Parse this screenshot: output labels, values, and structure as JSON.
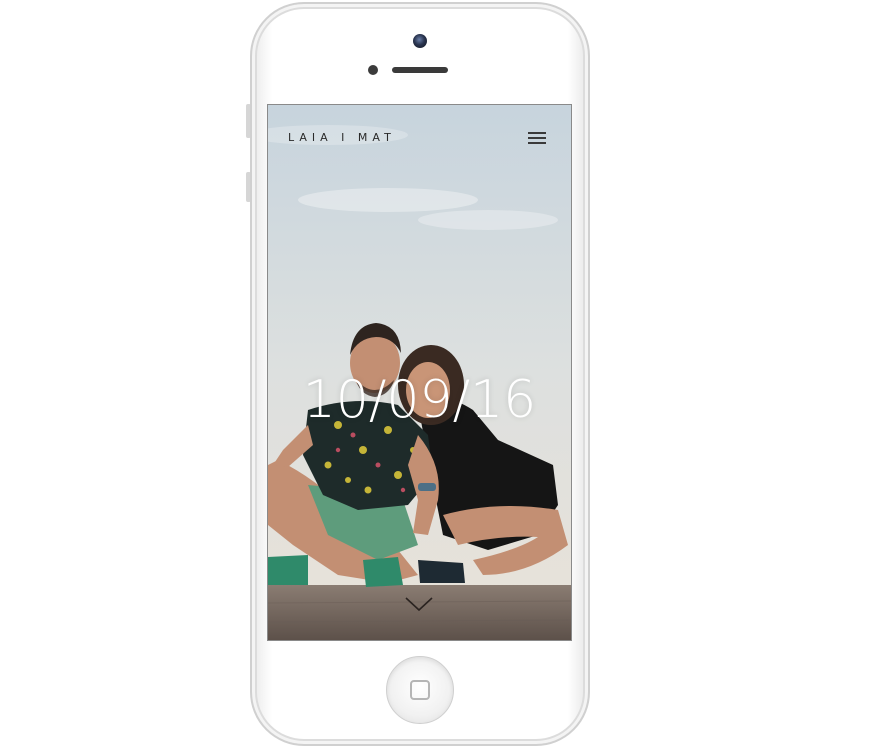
{
  "site": {
    "title": "LAIA I MAT",
    "menu_icon": "hamburger-menu-icon"
  },
  "hero": {
    "date": "10/09/16",
    "scroll_icon": "chevron-down-icon"
  },
  "device": {
    "model": "smartphone",
    "color": "#ffffff"
  },
  "colors": {
    "sky_top": "#c9d6df",
    "sky_bottom": "#e6e4df",
    "deck": "#6b5d55",
    "shirt": "#1f2a28",
    "shorts": "#5c9a7a",
    "dress": "#141414",
    "skin": "#c99577"
  }
}
